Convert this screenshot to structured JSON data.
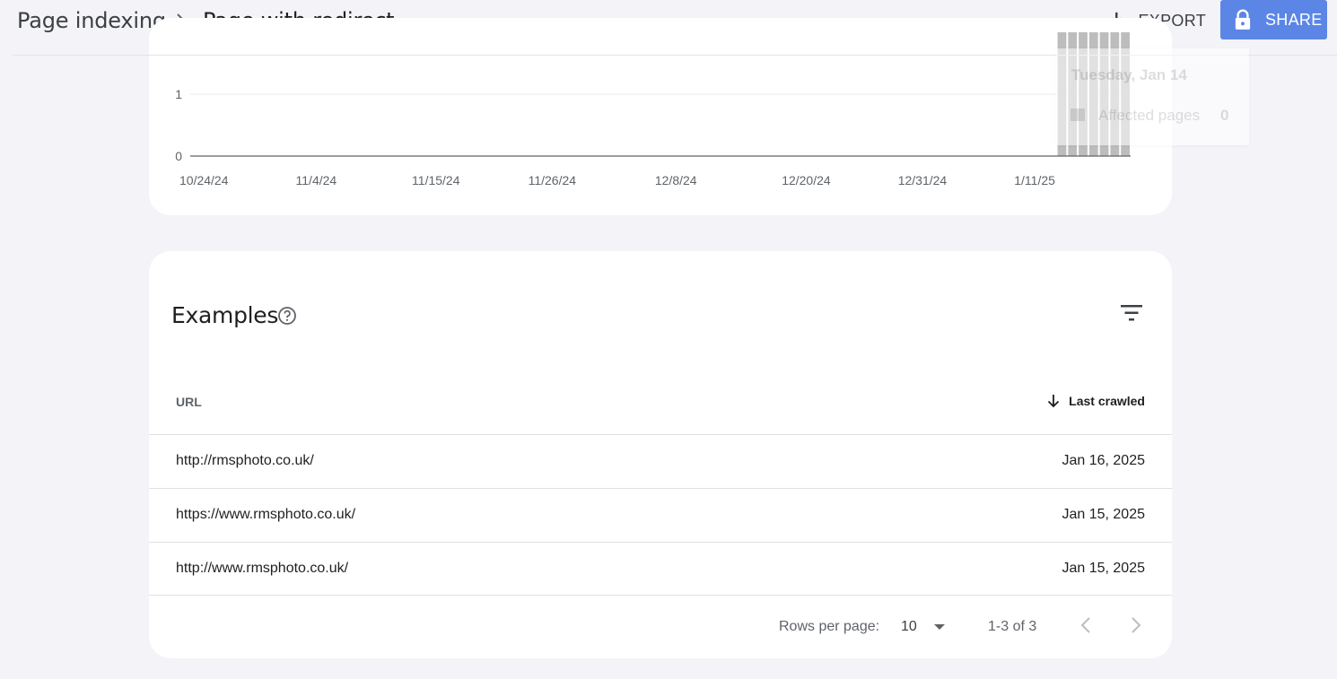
{
  "header": {
    "breadcrumb_parent": "Page indexing",
    "breadcrumb_current": "Page with redirect",
    "export_label": "EXPORT",
    "share_label": "SHARE",
    "share_color": "#5b86e5"
  },
  "chart_data": {
    "type": "bar",
    "y_ticks": [
      "0",
      "1"
    ],
    "x_tick_labels": [
      "10/24/24",
      "11/4/24",
      "11/15/24",
      "11/26/24",
      "12/8/24",
      "12/20/24",
      "12/31/24",
      "1/11/25"
    ],
    "series": [
      {
        "values": [
          0,
          0,
          0,
          0,
          0,
          0,
          0,
          0,
          0,
          0,
          0,
          0,
          0,
          0,
          0,
          0,
          0,
          0,
          0,
          0,
          0,
          0,
          0,
          0,
          0,
          0,
          0,
          0,
          0,
          0,
          0,
          0,
          0,
          0,
          0,
          0,
          0,
          0,
          0,
          0,
          0,
          0,
          0,
          0,
          0,
          0,
          0,
          0,
          0,
          0,
          0,
          0,
          0,
          0,
          0,
          0,
          0,
          0,
          0,
          0,
          0,
          0,
          0,
          0,
          0,
          0,
          0,
          0,
          0,
          0,
          0,
          0,
          0,
          0,
          0,
          0,
          0,
          0,
          0,
          0,
          0,
          0,
          2,
          2,
          2,
          2,
          2,
          2,
          2
        ],
        "color": "#bdbdbd"
      }
    ],
    "ylim": [
      0,
      2
    ],
    "grid": true
  },
  "tooltip": {
    "date": "Tuesday, Jan 14",
    "label": "Affected pages",
    "value": "0"
  },
  "examples": {
    "title": "Examples",
    "col_url": "URL",
    "col_last_crawled": "Last crawled",
    "rows": [
      {
        "url": "http://rmsphoto.co.uk/",
        "date": "Jan 16, 2025"
      },
      {
        "url": "https://www.rmsphoto.co.uk/",
        "date": "Jan 15, 2025"
      },
      {
        "url": "http://www.rmsphoto.co.uk/",
        "date": "Jan 15, 2025"
      }
    ],
    "rows_per_page_label": "Rows per page:",
    "rows_per_page_value": "10",
    "range_label": "1-3 of 3"
  },
  "icons": {
    "export": "download-icon",
    "share": "lock-icon",
    "help": "help-circle-icon",
    "filter": "filter-icon",
    "sort": "arrow-down-icon",
    "dropdown": "caret-down-icon",
    "prev": "chevron-left-icon",
    "next": "chevron-right-icon"
  }
}
